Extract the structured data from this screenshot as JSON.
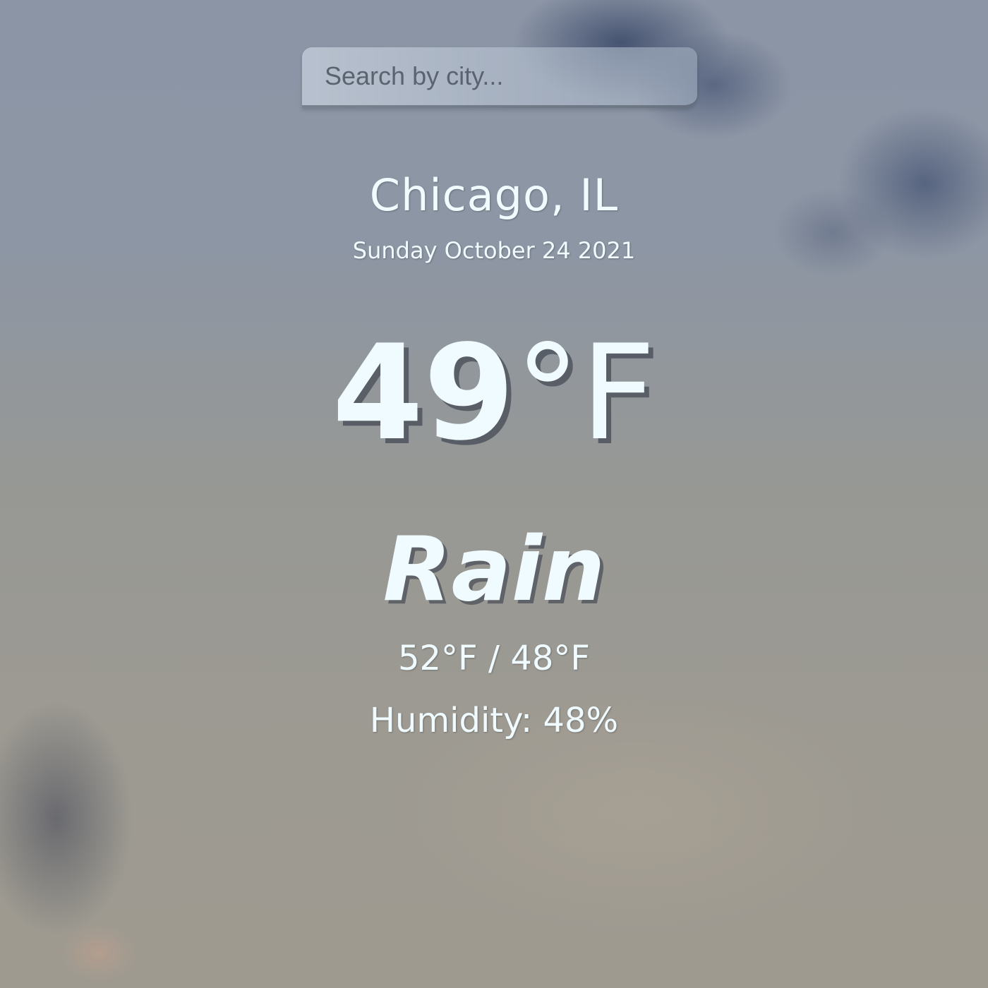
{
  "search": {
    "placeholder": "Search by city...",
    "value": ""
  },
  "location": {
    "city": "Chicago, IL",
    "date": "Sunday October 24 2021"
  },
  "weather": {
    "temperature": "49",
    "unit": "°F",
    "condition": "Rain",
    "high_low": "52°F / 48°F",
    "humidity": "Humidity: 48%"
  },
  "colors": {
    "text": "#f0fbff",
    "temperature_shadow": "#464b55"
  }
}
